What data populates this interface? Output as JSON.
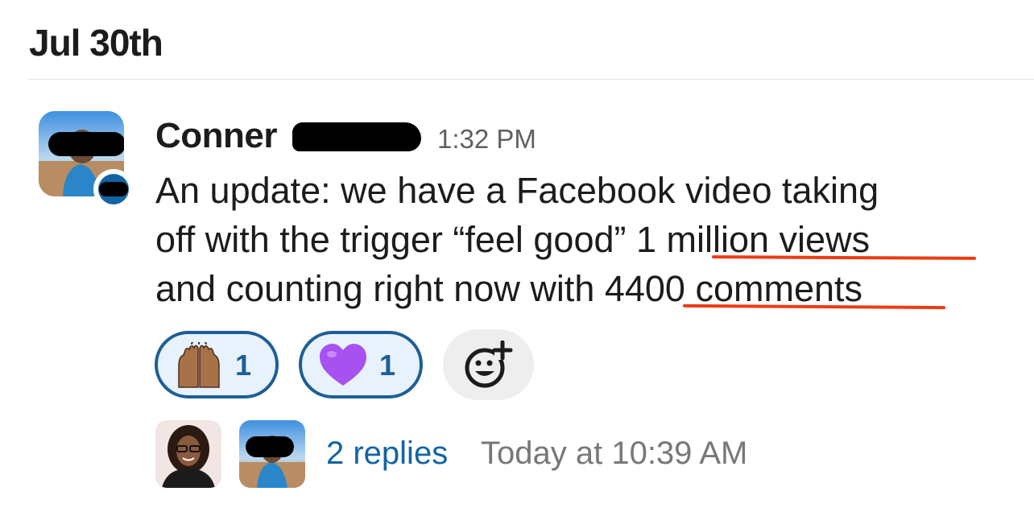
{
  "day_divider": {
    "label": "Jul 30th"
  },
  "message": {
    "sender": "Conner",
    "time": "1:32 PM",
    "body": {
      "line1": "An update: we have a Facebook video taking",
      "line2_pre": "off with the trigger “feel good” ",
      "line2_hl": "1 million views",
      "line3_pre": "and counting right now with ",
      "line3_hl": "4400 comments"
    },
    "highlight_color": "#ec3c13",
    "reactions": [
      {
        "emoji": "raised-hands-icon",
        "count": "1"
      },
      {
        "emoji": "purple-heart-icon",
        "count": "1"
      }
    ],
    "add_reaction_icon": "add-reaction-icon"
  },
  "thread": {
    "replies_label": "2 replies",
    "last_reply": "Today at 10:39 AM"
  },
  "colors": {
    "link": "#1264a3",
    "reaction_border": "#1d5f95",
    "reaction_bg": "#e8f2fc"
  }
}
